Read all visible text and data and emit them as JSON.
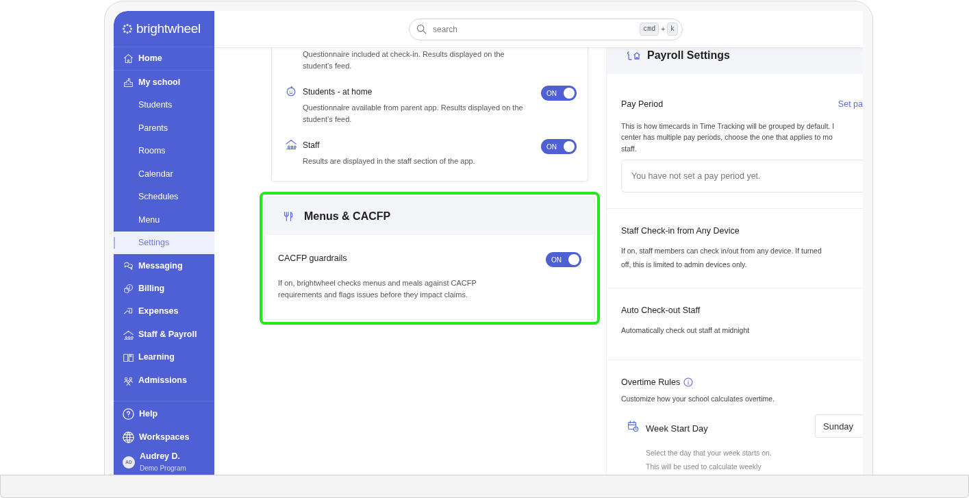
{
  "sidebar": {
    "logo": "brightwheel",
    "items": [
      {
        "label": "Home",
        "kind": "main",
        "selected": false
      },
      {
        "label": "My school",
        "kind": "main",
        "selected": false
      },
      {
        "label": "Students",
        "kind": "sub",
        "selected": false
      },
      {
        "label": "Parents",
        "kind": "sub",
        "selected": false
      },
      {
        "label": "Rooms",
        "kind": "sub",
        "selected": false
      },
      {
        "label": "Calendar",
        "kind": "sub",
        "selected": false
      },
      {
        "label": "Schedules",
        "kind": "sub",
        "selected": false
      },
      {
        "label": "Menu",
        "kind": "sub",
        "selected": false
      },
      {
        "label": "Settings",
        "kind": "sub",
        "selected": true
      },
      {
        "label": "Messaging",
        "kind": "main",
        "selected": false
      },
      {
        "label": "Billing",
        "kind": "main",
        "selected": false
      },
      {
        "label": "Expenses",
        "kind": "main",
        "selected": false
      },
      {
        "label": "Staff & Payroll",
        "kind": "main",
        "selected": false
      },
      {
        "label": "Learning",
        "kind": "main",
        "selected": false
      },
      {
        "label": "Admissions",
        "kind": "main",
        "selected": false
      }
    ],
    "footer_items": [
      {
        "label": "Help"
      },
      {
        "label": "Workspaces"
      }
    ],
    "user": {
      "initials": "AD",
      "name": "Audrey D.",
      "program": "Demo Program"
    }
  },
  "search": {
    "placeholder": "search",
    "shortcut": [
      "cmd",
      "+",
      "k"
    ]
  },
  "health_card": {
    "items": [
      {
        "description": "Questionnaire included at check-in. Results displayed on the student’s feed."
      },
      {
        "title": "Students - at home",
        "description": "Questionnaire available from parent app. Results displayed on the student’s feed.",
        "toggle": {
          "label": "ON",
          "on": true
        }
      },
      {
        "title": "Staff",
        "description": "Results are displayed in the staff section of the app.",
        "toggle": {
          "label": "ON",
          "on": true
        }
      }
    ]
  },
  "menus_card": {
    "title": "Menus & CACFP",
    "highlighted": true,
    "setting": {
      "title": "CACFP guardrails",
      "description": "If on, brightwheel checks menus and meals against CACFP requirements and flags issues before they impact claims.",
      "toggle": {
        "label": "ON",
        "on": true
      }
    }
  },
  "payroll": {
    "title": "Payroll Settings",
    "pay_period": {
      "title": "Pay Period",
      "link": "Set pa",
      "description_lines": [
        "This is how timecards in Time Tracking will be grouped by default. I",
        "center has multiple pay periods, choose the one that applies to mo",
        "staff."
      ],
      "empty_message": "You have not set a pay period yet."
    },
    "staff_checkin": {
      "title": "Staff Check-in from Any Device",
      "description": "If on, staff members can check in/out from any device. If turned off, this is limited to admin devices only."
    },
    "auto_checkout": {
      "title": "Auto Check-out Staff",
      "description": "Automatically check out staff at midnight"
    },
    "overtime": {
      "title": "Overtime Rules",
      "description": "Customize how your school calculates overtime.",
      "week_start": {
        "title": "Week Start Day",
        "value": "Sunday",
        "description_lines": [
          "Select the day that your week starts on.",
          "This will be used to calculate weekly"
        ]
      }
    }
  }
}
